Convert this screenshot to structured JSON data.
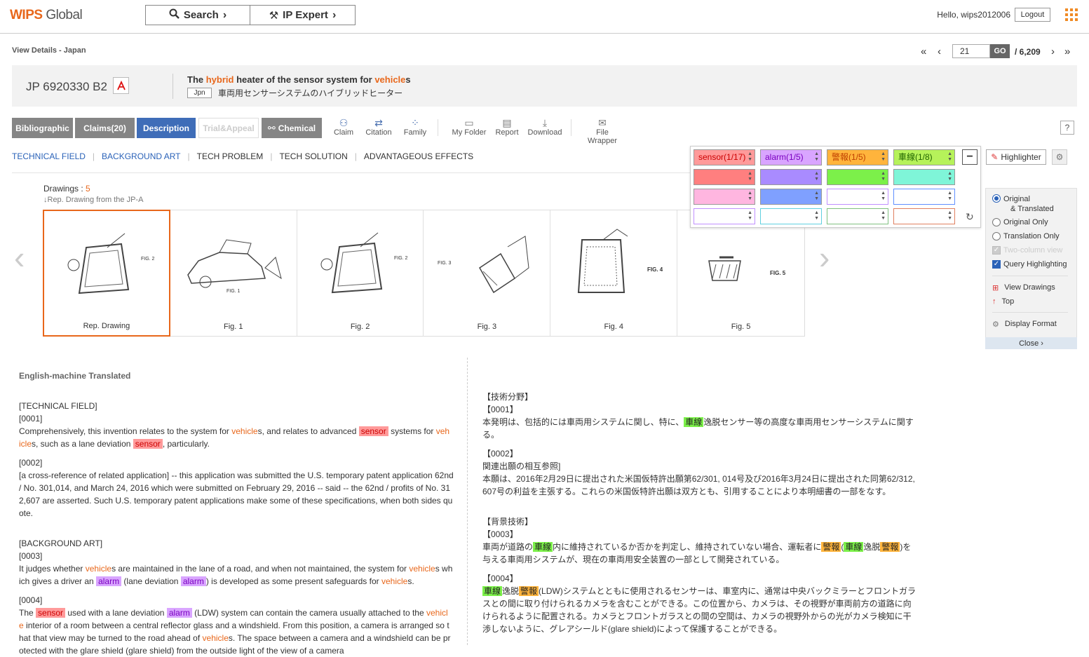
{
  "header": {
    "logo_main": "WIPS",
    "logo_sub": " Global",
    "search_label": "Search",
    "ipexpert_label": "IP Expert",
    "hello": "Hello, wips2012006",
    "logout": "Logout"
  },
  "nav": {
    "view_details": "View Details - Japan",
    "first": "«",
    "prev": "‹",
    "page_value": "21",
    "go": "GO",
    "total": "/ 6,209",
    "next": "›",
    "last": "»"
  },
  "doc": {
    "number": "JP 6920330 B2",
    "title_pre": "The ",
    "title_hl1": "hybrid",
    "title_mid": " heater of the sensor system for ",
    "title_hl2": "vehicle",
    "title_post": "s",
    "lang_tag": "Jpn",
    "title_jp": "車両用センサーシステムのハイブリッドヒーター"
  },
  "tabs": {
    "bibliographic": "Bibliographic",
    "claims": "Claims(20)",
    "description": "Description",
    "trial": "Trial&Appeal",
    "chemical": "Chemical"
  },
  "tools": {
    "claim": "Claim",
    "citation": "Citation",
    "family": "Family",
    "my_folder": "My Folder",
    "report": "Report",
    "download": "Download",
    "file_wrapper": "File Wrapper",
    "help": "?"
  },
  "sections": [
    "TECHNICAL FIELD",
    "BACKGROUND ART",
    "TECH PROBLEM",
    "TECH SOLUTION",
    "ADVANTAGEOUS EFFECTS"
  ],
  "drawings": {
    "label": "Drawings : ",
    "count": "5",
    "sub": "↓Rep. Drawing from the JP-A",
    "captions": [
      "Rep. Drawing",
      "Fig. 1",
      "Fig. 2",
      "Fig. 3",
      "Fig. 4",
      "Fig. 5"
    ]
  },
  "highlighter": {
    "terms": [
      "sensor(1/17)",
      "alarm(1/5)",
      "警報(1/5)",
      "車線(1/8)"
    ],
    "button": "Highlighter",
    "colors": {
      "row0": [
        "#ff9a9a",
        "#d9a5ff",
        "#ffb43c",
        "#b6f25a"
      ],
      "row1": [
        "#ff7f7f",
        "#a98bff",
        "#7cf04a",
        "#7ff5d8"
      ],
      "row2": [
        "#ffb6e0",
        "#7fa0ff",
        "#ffffff",
        "#ffffff"
      ],
      "row3": [
        "#ffffff",
        "#ffffff",
        "#ffffff",
        "#ffffff"
      ]
    }
  },
  "options": {
    "original_translated_1": "Original",
    "original_translated_2": "& Translated",
    "original_only": "Original Only",
    "translation_only": "Translation Only",
    "two_column": "Two-column view",
    "query_highlighting": "Query Highlighting",
    "view_drawings": "View Drawings",
    "top": "Top",
    "display_format": "Display Format",
    "close": "Close"
  },
  "english": {
    "heading": "English-machine Translated",
    "tf": "[TECHNICAL FIELD]",
    "p1": "[0001]",
    "p2": "[0002]",
    "p2text": "[a cross-reference of related application] -- this application was submitted the U.S. temporary patent application 62nd / No. 301,014, and March 24, 2016 which were submitted on February 29, 2016 -- said -- the 62nd / profits of No. 31 2,607 are asserted. Such U.S. temporary patent applications make some of these specifications, when both sides qu ote.",
    "ba": "[BACKGROUND ART]",
    "p3": "[0003]",
    "p4": "[0004]"
  },
  "japanese": {
    "tf": "【技術分野】",
    "p1": "【0001】",
    "p2": "【0002】",
    "p2a": "関連出願の相互参照]",
    "p2b": "本願は、2016年2月29日に提出された米国仮特許出願第62/301, 014号及び2016年3月24日に提出された同第62/312, 607号の利益を主張する。これらの米国仮特許出願は双方とも、引用することにより本明細書の一部をなす。",
    "ba": "【背景技術】",
    "p3": "【0003】",
    "p4": "【0004】"
  }
}
